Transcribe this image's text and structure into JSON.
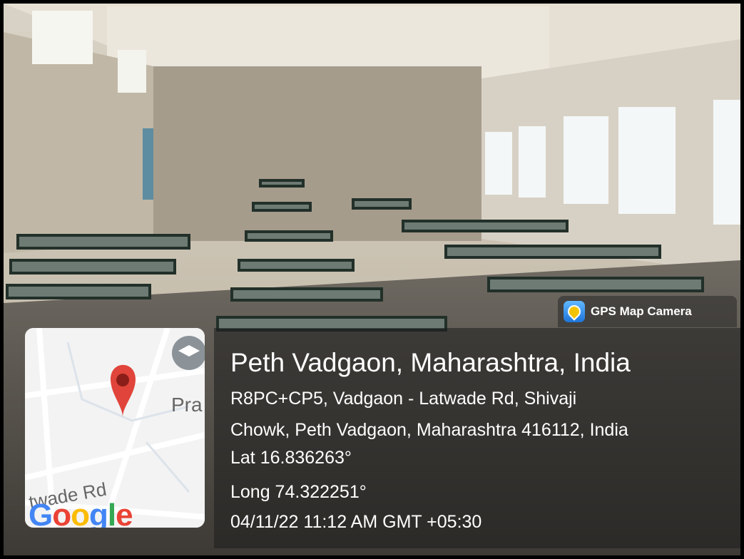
{
  "watermark": {
    "app_name": "GPS Map Camera"
  },
  "location": {
    "title": "Peth Vadgaon, Maharashtra, India",
    "address_line1": "R8PC+CP5, Vadgaon - Latwade Rd, Shivaji",
    "address_line2": "Chowk, Peth Vadgaon, Maharashtra 416112, India",
    "latitude": "Lat 16.836263°",
    "longitude": "Long 74.322251°",
    "timestamp": "04/11/22 11:12 AM GMT +05:30"
  },
  "map": {
    "road_label": "twade Rd",
    "place_label": "Pra",
    "google_logo": "Google",
    "pin_color": "#e0443a"
  },
  "colors": {
    "overlay": "#1e1e1e",
    "text": "#ffffff",
    "room_wall": "#cfc8b9",
    "desk": "#1f2b24"
  }
}
